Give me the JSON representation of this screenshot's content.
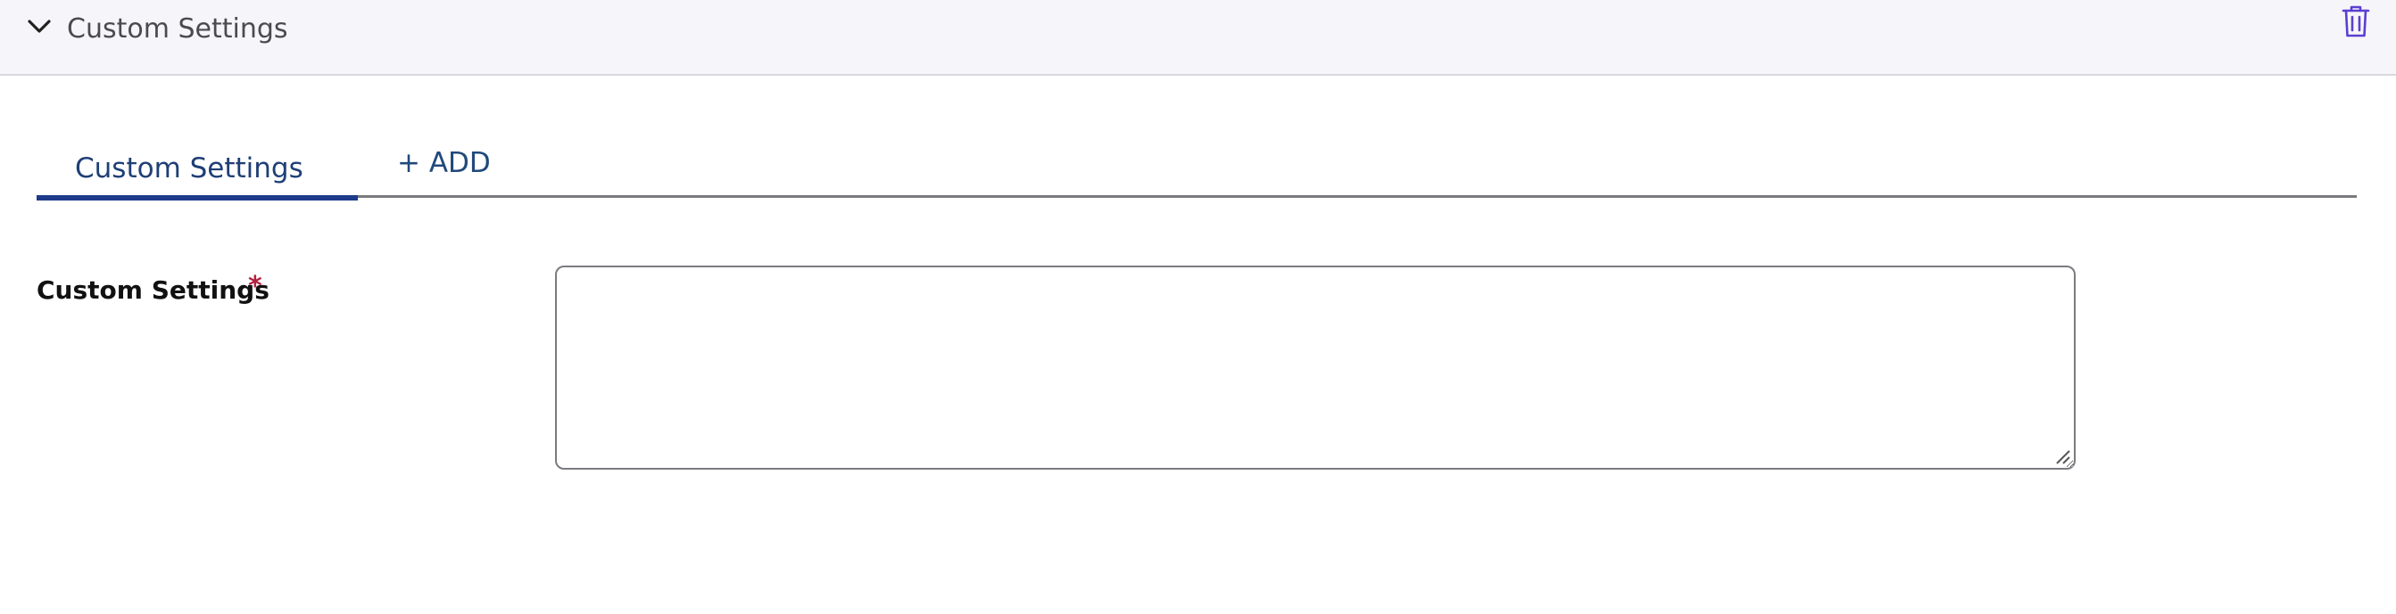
{
  "header": {
    "title": "Custom Settings",
    "collapse_icon": "chevron-down-icon",
    "delete_icon": "trash-icon",
    "delete_icon_color": "#5b3fd0"
  },
  "tabs": [
    {
      "label": "Custom Settings",
      "active": true
    },
    {
      "label": "+ ADD",
      "active": false
    }
  ],
  "field": {
    "label": "Custom Settings",
    "required_marker": "*",
    "value": "",
    "placeholder": ""
  },
  "colors": {
    "header_background": "#f6f6fa",
    "tab_active_underline": "#1e3b8a",
    "tab_text": "#1f3f76",
    "required_marker": "#b3203f"
  }
}
